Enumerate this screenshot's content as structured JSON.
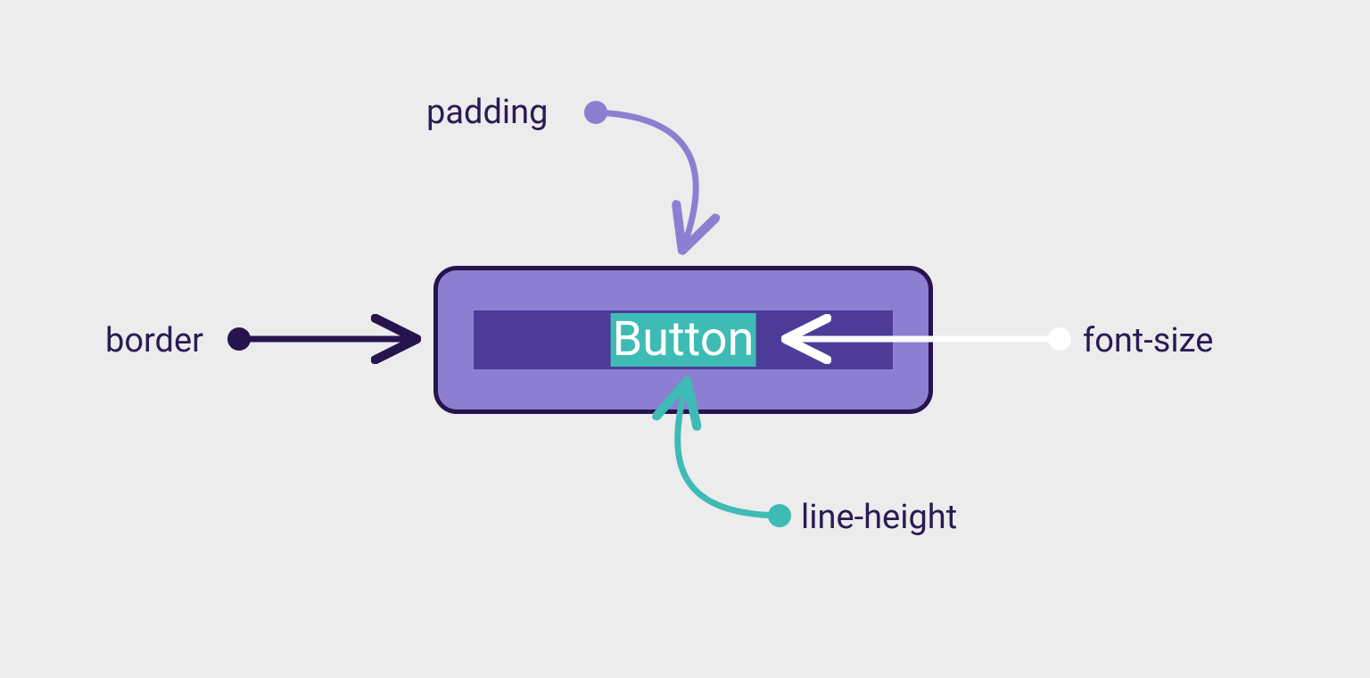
{
  "diagram": {
    "button_label": "Button",
    "annotations": {
      "padding": "padding",
      "border": "border",
      "font_size": "font-size",
      "line_height": "line-height"
    },
    "colors": {
      "bg": "#ececec",
      "border": "#26144f",
      "padding_area": "#8c7fd1",
      "content_area": "#4d3b98",
      "text_bg": "#3ebbb5",
      "text": "#ffffff",
      "label": "#2a1b54",
      "arrow_padding": "#8c7fd1",
      "arrow_border": "#26144f",
      "arrow_fontsize": "#ffffff",
      "arrow_lineheight": "#3ebbb5"
    }
  }
}
